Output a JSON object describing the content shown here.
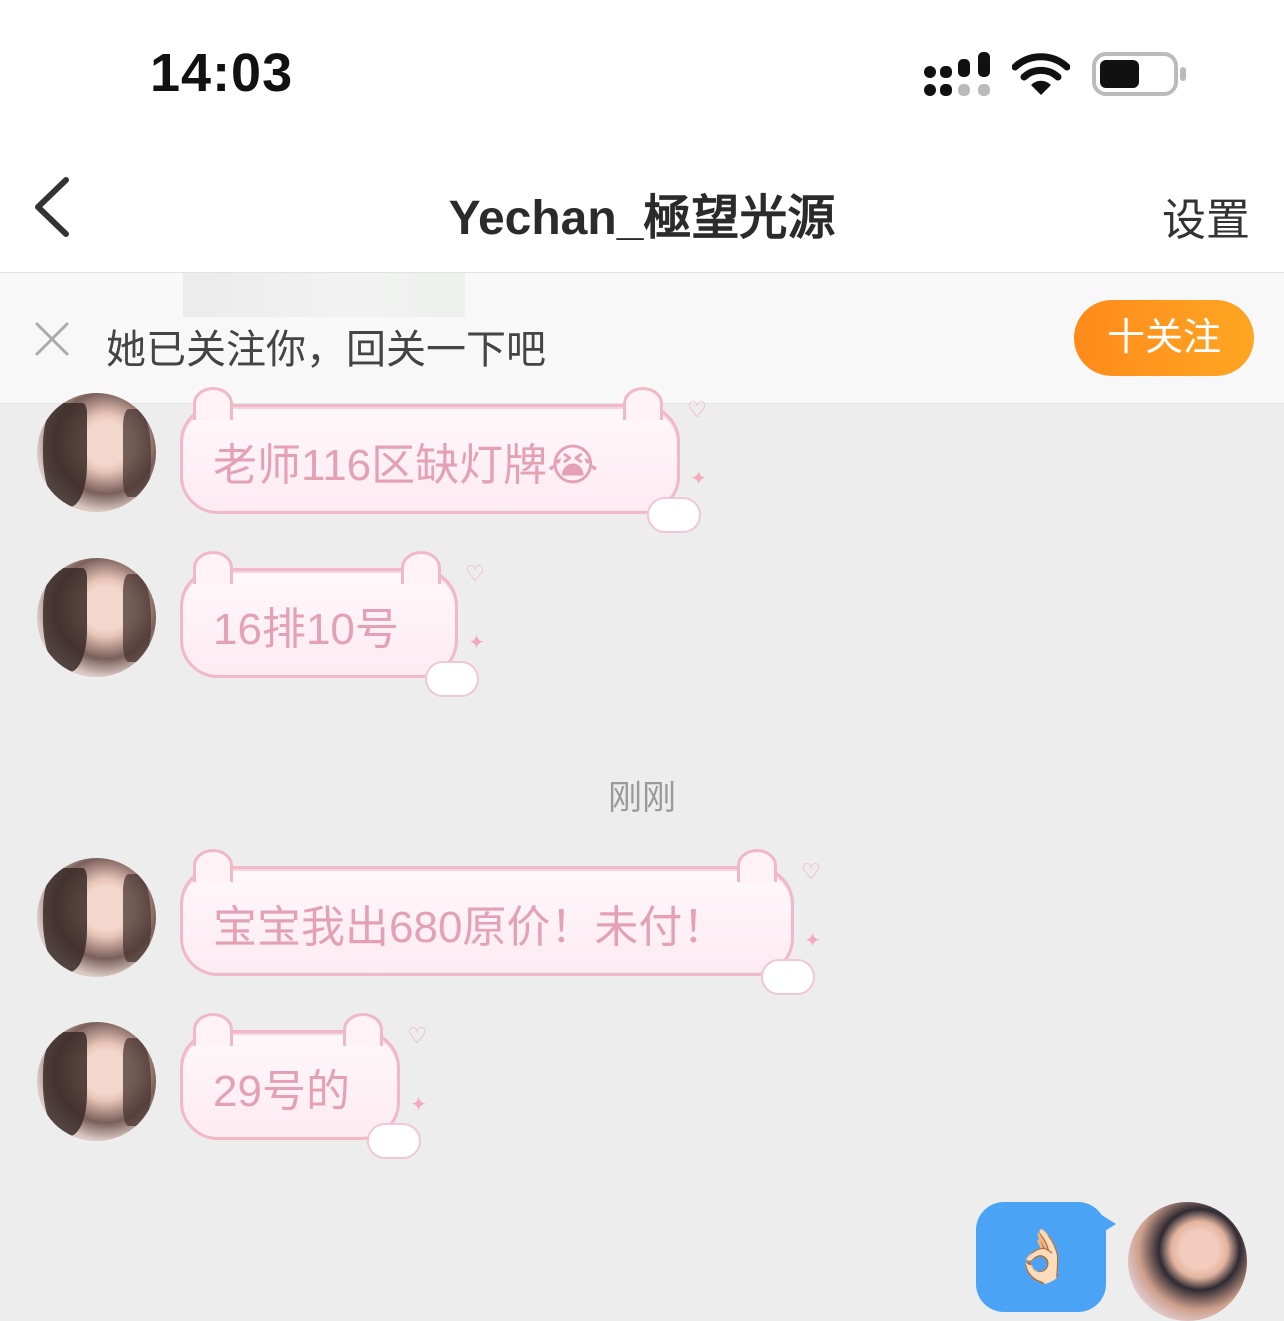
{
  "status_bar": {
    "time": "14:03",
    "battery_level": 0.55
  },
  "nav": {
    "back_icon": "chevron-left-icon",
    "title": "Yechan_極望光源",
    "settings_label": "设置"
  },
  "banner": {
    "close_icon": "close-icon",
    "text": "她已关注你，回关一下吧",
    "follow_label": "十关注"
  },
  "messages": [
    {
      "text": "老师116区缺灯牌",
      "emoji": "😭"
    },
    {
      "text": "16排10号"
    },
    {
      "text": "宝宝我出680原价！未付！"
    },
    {
      "text": "29号的"
    }
  ],
  "time_divider": "刚刚",
  "sent_message": {
    "emoji": "👌🏻"
  },
  "colors": {
    "accent": "#ff9a1f",
    "sent_bubble": "#4aa3f5",
    "bubble_text": "#e4a1b6",
    "bubble_border": "#f0b8c8"
  }
}
